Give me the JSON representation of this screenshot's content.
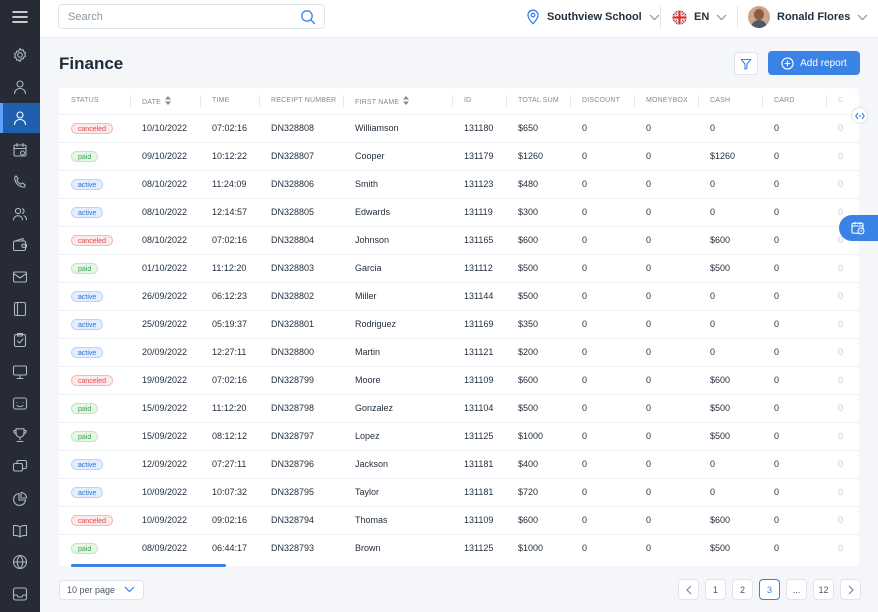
{
  "sidebar": {
    "menu_icon": "hamburger-icon",
    "items": [
      {
        "icon": "settings-icon",
        "active": false
      },
      {
        "icon": "user-icon",
        "active": false
      },
      {
        "icon": "user-icon",
        "active": true
      },
      {
        "icon": "calendar-icon",
        "active": false
      },
      {
        "icon": "phone-icon",
        "active": false
      },
      {
        "icon": "users-icon",
        "active": false
      },
      {
        "icon": "wallet-icon",
        "active": false
      },
      {
        "icon": "mail-icon",
        "active": false
      },
      {
        "icon": "book-icon",
        "active": false
      },
      {
        "icon": "clipboard-check-icon",
        "active": false
      },
      {
        "icon": "monitor-icon",
        "active": false
      },
      {
        "icon": "chat-icon",
        "active": false
      },
      {
        "icon": "trophy-icon",
        "active": false
      },
      {
        "icon": "chat-bubbles-icon",
        "active": false
      },
      {
        "icon": "pie-chart-icon",
        "active": false
      },
      {
        "icon": "open-book-icon",
        "active": false
      },
      {
        "icon": "globe-icon",
        "active": false
      },
      {
        "icon": "inbox-icon",
        "active": false
      }
    ]
  },
  "header": {
    "search_placeholder": "Search",
    "school": "Southview School",
    "language": "EN",
    "user_name": "Ronald Flores"
  },
  "page": {
    "title": "Finance",
    "add_report_label": "Add report"
  },
  "table": {
    "columns": [
      "STATUS",
      "DATE",
      "TIME",
      "RECEIPT NUMBER",
      "FIRST NAME",
      "ID",
      "TOTAL SUM",
      "DISCOUNT",
      "MONEYBOX",
      "CASH",
      "CARD",
      "C"
    ],
    "rows": [
      {
        "status": "canceled",
        "date": "10/10/2022",
        "time": "07:02:16",
        "receipt": "DN328808",
        "name": "Williamson",
        "id": "131180",
        "total": "$650",
        "discount": "0",
        "moneybox": "0",
        "cash": "0",
        "card": "0",
        "extra": "0"
      },
      {
        "status": "paid",
        "date": "09/10/2022",
        "time": "10:12:22",
        "receipt": "DN328807",
        "name": "Cooper",
        "id": "131179",
        "total": "$1260",
        "discount": "0",
        "moneybox": "0",
        "cash": "$1260",
        "card": "0",
        "extra": "0"
      },
      {
        "status": "active",
        "date": "08/10/2022",
        "time": "11:24:09",
        "receipt": "DN328806",
        "name": "Smith",
        "id": "131123",
        "total": "$480",
        "discount": "0",
        "moneybox": "0",
        "cash": "0",
        "card": "0",
        "extra": "0"
      },
      {
        "status": "active",
        "date": "08/10/2022",
        "time": "12:14:57",
        "receipt": "DN328805",
        "name": "Edwards",
        "id": "131119",
        "total": "$300",
        "discount": "0",
        "moneybox": "0",
        "cash": "0",
        "card": "0",
        "extra": "0"
      },
      {
        "status": "canceled",
        "date": "08/10/2022",
        "time": "07:02:16",
        "receipt": "DN328804",
        "name": "Johnson",
        "id": "131165",
        "total": "$600",
        "discount": "0",
        "moneybox": "0",
        "cash": "$600",
        "card": "0",
        "extra": "0"
      },
      {
        "status": "paid",
        "date": "01/10/2022",
        "time": "11:12:20",
        "receipt": "DN328803",
        "name": "Garcia",
        "id": "131112",
        "total": "$500",
        "discount": "0",
        "moneybox": "0",
        "cash": "$500",
        "card": "0",
        "extra": "0"
      },
      {
        "status": "active",
        "date": "26/09/2022",
        "time": "06:12:23",
        "receipt": "DN328802",
        "name": "Miller",
        "id": "131144",
        "total": "$500",
        "discount": "0",
        "moneybox": "0",
        "cash": "0",
        "card": "0",
        "extra": "0"
      },
      {
        "status": "active",
        "date": "25/09/2022",
        "time": "05:19:37",
        "receipt": "DN328801",
        "name": "Rodriguez",
        "id": "131169",
        "total": "$350",
        "discount": "0",
        "moneybox": "0",
        "cash": "0",
        "card": "0",
        "extra": "0"
      },
      {
        "status": "active",
        "date": "20/09/2022",
        "time": "12:27:11",
        "receipt": "DN328800",
        "name": "Martin",
        "id": "131121",
        "total": "$200",
        "discount": "0",
        "moneybox": "0",
        "cash": "0",
        "card": "0",
        "extra": "0"
      },
      {
        "status": "canceled",
        "date": "19/09/2022",
        "time": "07:02:16",
        "receipt": "DN328799",
        "name": "Moore",
        "id": "131109",
        "total": "$600",
        "discount": "0",
        "moneybox": "0",
        "cash": "$600",
        "card": "0",
        "extra": "0"
      },
      {
        "status": "paid",
        "date": "15/09/2022",
        "time": "11:12:20",
        "receipt": "DN328798",
        "name": "Gonzalez",
        "id": "131104",
        "total": "$500",
        "discount": "0",
        "moneybox": "0",
        "cash": "$500",
        "card": "0",
        "extra": "0"
      },
      {
        "status": "paid",
        "date": "15/09/2022",
        "time": "08:12:12",
        "receipt": "DN328797",
        "name": "Lopez",
        "id": "131125",
        "total": "$1000",
        "discount": "0",
        "moneybox": "0",
        "cash": "$500",
        "card": "0",
        "extra": "0"
      },
      {
        "status": "active",
        "date": "12/09/2022",
        "time": "07:27:11",
        "receipt": "DN328796",
        "name": "Jackson",
        "id": "131181",
        "total": "$400",
        "discount": "0",
        "moneybox": "0",
        "cash": "0",
        "card": "0",
        "extra": "0"
      },
      {
        "status": "active",
        "date": "10/09/2022",
        "time": "10:07:32",
        "receipt": "DN328795",
        "name": "Taylor",
        "id": "131181",
        "total": "$720",
        "discount": "0",
        "moneybox": "0",
        "cash": "0",
        "card": "0",
        "extra": "0"
      },
      {
        "status": "canceled",
        "date": "10/09/2022",
        "time": "09:02:16",
        "receipt": "DN328794",
        "name": "Thomas",
        "id": "131109",
        "total": "$600",
        "discount": "0",
        "moneybox": "0",
        "cash": "$600",
        "card": "0",
        "extra": "0"
      },
      {
        "status": "paid",
        "date": "08/09/2022",
        "time": "06:44:17",
        "receipt": "DN328793",
        "name": "Brown",
        "id": "131125",
        "total": "$1000",
        "discount": "0",
        "moneybox": "0",
        "cash": "$500",
        "card": "0",
        "extra": "0"
      }
    ]
  },
  "footer": {
    "per_page": "10 per page",
    "pages": [
      "1",
      "2",
      "3",
      "...",
      "12"
    ],
    "current_page": "3"
  },
  "colors": {
    "sidebar_bg": "#262b36",
    "accent": "#3b82e6",
    "canceled": "#e24848",
    "paid": "#36a24a",
    "active": "#2f6fd4"
  }
}
